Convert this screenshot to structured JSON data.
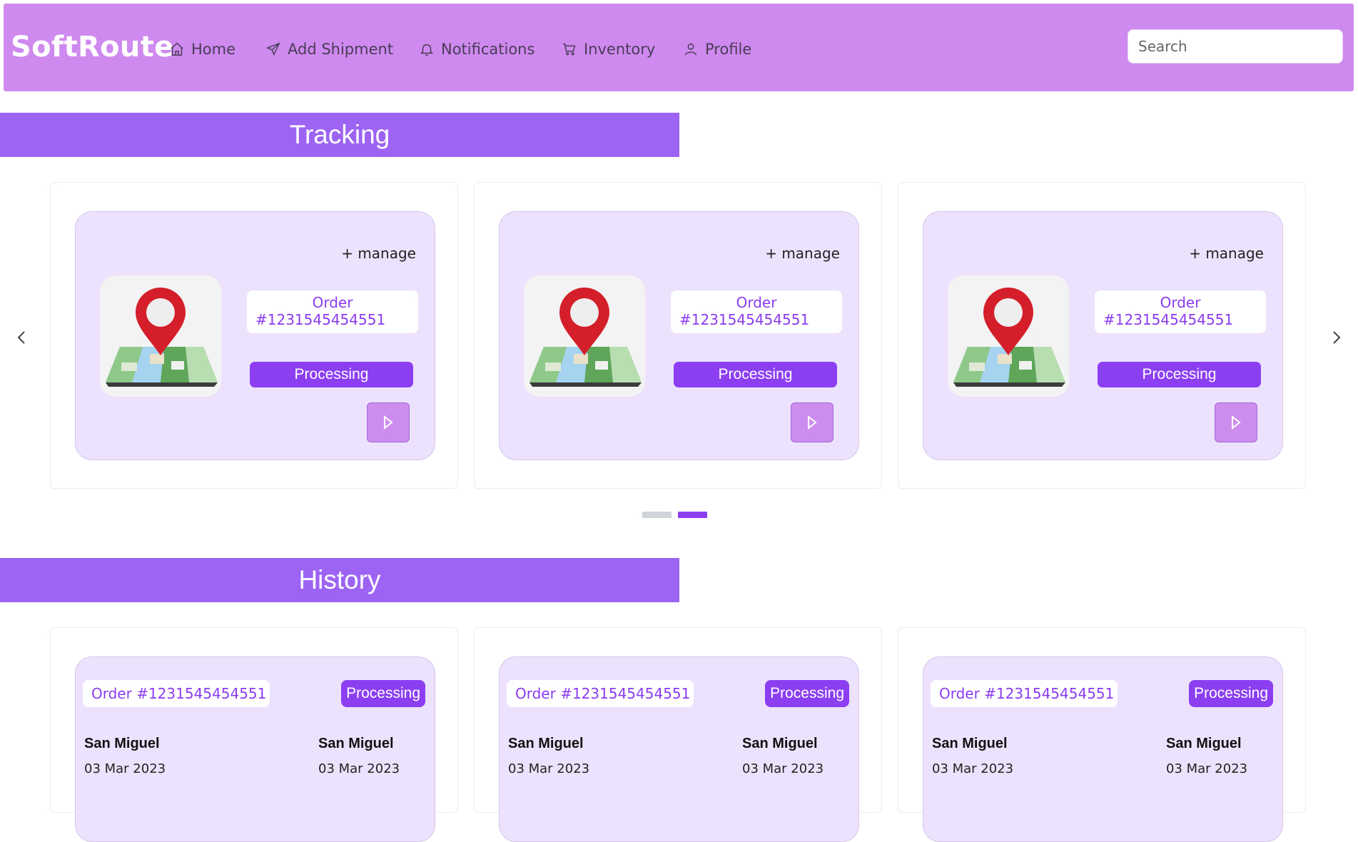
{
  "brand": "SoftRoute",
  "nav": [
    {
      "label": "Home",
      "icon": "home-icon"
    },
    {
      "label": "Add Shipment",
      "icon": "send-icon"
    },
    {
      "label": "Notifications",
      "icon": "bell-icon"
    },
    {
      "label": "Inventory",
      "icon": "cart-icon"
    },
    {
      "label": "Profile",
      "icon": "user-icon"
    }
  ],
  "search": {
    "placeholder": "Search",
    "value": ""
  },
  "tracking": {
    "title": "Tracking",
    "manage_label": "+ manage",
    "cards": [
      {
        "order_label": "Order",
        "order_number": "#1231545454551",
        "status": "Processing"
      },
      {
        "order_label": "Order",
        "order_number": "#1231545454551",
        "status": "Processing"
      },
      {
        "order_label": "Order",
        "order_number": "#1231545454551",
        "status": "Processing"
      }
    ],
    "pagination": {
      "pages": 2,
      "active": 2
    }
  },
  "history": {
    "title": "History",
    "cards": [
      {
        "order": "Order #1231545454551",
        "status": "Processing",
        "from_city": "San Miguel",
        "to_city": "San Miguel",
        "from_date": "03 Mar 2023",
        "to_date": "03 Mar 2023"
      },
      {
        "order": "Order #1231545454551",
        "status": "Processing",
        "from_city": "San Miguel",
        "to_city": "San Miguel",
        "from_date": "03 Mar 2023",
        "to_date": "03 Mar 2023"
      },
      {
        "order": "Order #1231545454551",
        "status": "Processing",
        "from_city": "San Miguel",
        "to_city": "San Miguel",
        "from_date": "03 Mar 2023",
        "to_date": "03 Mar 2023"
      }
    ]
  },
  "colors": {
    "navbar": "#cf8aef",
    "section_header": "#9d63f3",
    "accent": "#8b3ff0",
    "card_bg": "#ece2fd",
    "play_button": "#cd8def",
    "dot_inactive": "#d0d3da",
    "dot_active": "#8b3ff0"
  }
}
